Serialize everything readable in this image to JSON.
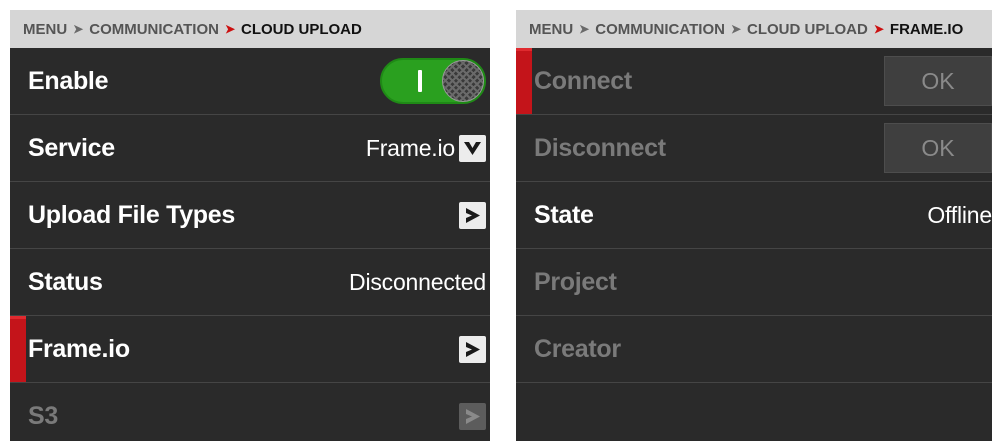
{
  "left": {
    "breadcrumb": {
      "items": [
        "MENU",
        "COMMUNICATION"
      ],
      "current": "CLOUD UPLOAD"
    },
    "rows": {
      "enable": {
        "label": "Enable",
        "toggle_on": true
      },
      "service": {
        "label": "Service",
        "value": "Frame.io"
      },
      "upload_file_types": {
        "label": "Upload File Types"
      },
      "status": {
        "label": "Status",
        "value": "Disconnected"
      },
      "frameio": {
        "label": "Frame.io"
      },
      "s3": {
        "label": "S3"
      }
    }
  },
  "right": {
    "breadcrumb": {
      "items": [
        "MENU",
        "COMMUNICATION",
        "CLOUD UPLOAD"
      ],
      "current": "FRAME.IO"
    },
    "rows": {
      "connect": {
        "label": "Connect",
        "button": "OK"
      },
      "disconnect": {
        "label": "Disconnect",
        "button": "OK"
      },
      "state": {
        "label": "State",
        "value": "Offline"
      },
      "project": {
        "label": "Project"
      },
      "creator": {
        "label": "Creator"
      }
    }
  },
  "colors": {
    "panel_bg": "#2a2a2a",
    "breadcrumb_bg": "#d6d6d6",
    "accent_red": "#c4141a",
    "toggle_green": "#2aa01f",
    "disabled_text": "#7a7a7a"
  },
  "icons": {
    "dropdown": "chevron-down-icon",
    "submenu": "chevron-right-icon"
  }
}
